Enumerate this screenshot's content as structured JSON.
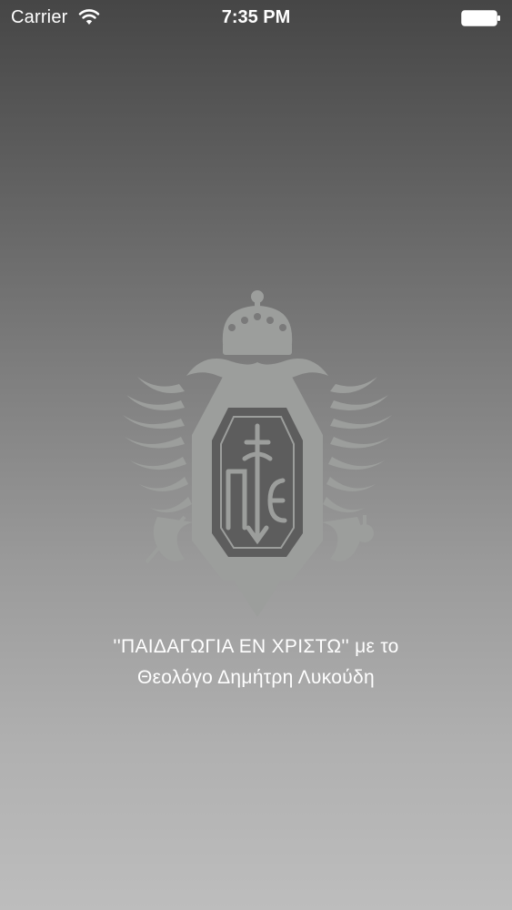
{
  "status_bar": {
    "carrier": "Carrier",
    "time": "7:35 PM",
    "icons": [
      "wifi-icon",
      "battery-icon"
    ]
  },
  "splash": {
    "emblem": "crowned-double-headed-eagle-crest",
    "caption_line1": "''ΠΑΙΔΑΓΩΓΙΑ ΕΝ ΧΡΙΣΤΩ'' με το",
    "caption_line2": "Θεολόγο Δημήτρη Λυκούδη"
  },
  "colors": {
    "background_top": "#464646",
    "background_bottom": "#bdbdbd",
    "emblem": "#9c9e9c",
    "text": "#ffffff"
  }
}
